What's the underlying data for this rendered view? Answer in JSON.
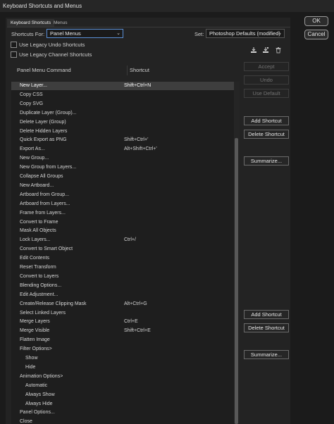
{
  "window": {
    "title": "Keyboard Shortcuts and Menus"
  },
  "tabs": [
    {
      "label": "Keyboard Shortcuts"
    },
    {
      "label": "Menus"
    }
  ],
  "shortcuts_for": {
    "label": "Shortcuts For:",
    "value": "Panel Menus"
  },
  "set": {
    "label": "Set:",
    "value": "Photoshop Defaults (modified)"
  },
  "options": {
    "legacy_undo": {
      "label": "Use Legacy Undo Shortcuts",
      "checked": false
    },
    "legacy_channel": {
      "label": "Use Legacy Channel Shortcuts",
      "checked": false
    }
  },
  "icons": {
    "save_set": "save-set-icon",
    "save_set_copy": "save-set-copy-icon",
    "delete_set": "trash-icon"
  },
  "table": {
    "headers": {
      "command": "Panel Menu Command",
      "shortcut": "Shortcut"
    },
    "rows": [
      {
        "cmd": "New Layer...",
        "sc": "Shift+Ctrl+N",
        "indent": 1,
        "selected": true
      },
      {
        "cmd": "Copy CSS",
        "sc": "",
        "indent": 1
      },
      {
        "cmd": "Copy SVG",
        "sc": "",
        "indent": 1
      },
      {
        "cmd": "Duplicate Layer (Group)...",
        "sc": "",
        "indent": 1
      },
      {
        "cmd": "Delete Layer (Group)",
        "sc": "",
        "indent": 1
      },
      {
        "cmd": "Delete Hidden Layers",
        "sc": "",
        "indent": 1
      },
      {
        "cmd": "Quick Export as PNG",
        "sc": "Shift+Ctrl+'",
        "indent": 1
      },
      {
        "cmd": "Export As...",
        "sc": "Alt+Shift+Ctrl+'",
        "indent": 1
      },
      {
        "cmd": "New Group...",
        "sc": "",
        "indent": 1
      },
      {
        "cmd": "New Group from Layers...",
        "sc": "",
        "indent": 1
      },
      {
        "cmd": "Collapse All Groups",
        "sc": "",
        "indent": 1
      },
      {
        "cmd": "New Artboard...",
        "sc": "",
        "indent": 1
      },
      {
        "cmd": "Artboard from Group...",
        "sc": "",
        "indent": 1
      },
      {
        "cmd": "Artboard from Layers...",
        "sc": "",
        "indent": 1
      },
      {
        "cmd": "Frame from Layers...",
        "sc": "",
        "indent": 1
      },
      {
        "cmd": "Convert to Frame",
        "sc": "",
        "indent": 1
      },
      {
        "cmd": "Mask All Objects",
        "sc": "",
        "indent": 1
      },
      {
        "cmd": "Lock Layers...",
        "sc": "Ctrl+/",
        "indent": 1
      },
      {
        "cmd": "Convert to Smart Object",
        "sc": "",
        "indent": 1
      },
      {
        "cmd": "Edit Contents",
        "sc": "",
        "indent": 1
      },
      {
        "cmd": "Reset Transform",
        "sc": "",
        "indent": 1
      },
      {
        "cmd": "Convert to Layers",
        "sc": "",
        "indent": 1
      },
      {
        "cmd": "Blending Options...",
        "sc": "",
        "indent": 1
      },
      {
        "cmd": "Edit Adjustment...",
        "sc": "",
        "indent": 1
      },
      {
        "cmd": "Create/Release Clipping Mask",
        "sc": "Alt+Ctrl+G",
        "indent": 1
      },
      {
        "cmd": "Select Linked Layers",
        "sc": "",
        "indent": 1
      },
      {
        "cmd": "Merge Layers",
        "sc": "Ctrl+E",
        "indent": 1
      },
      {
        "cmd": "Merge Visible",
        "sc": "Shift+Ctrl+E",
        "indent": 1
      },
      {
        "cmd": "Flatten Image",
        "sc": "",
        "indent": 1
      },
      {
        "cmd": "Filter Options>",
        "sc": "",
        "indent": 1
      },
      {
        "cmd": "Show",
        "sc": "",
        "indent": 2
      },
      {
        "cmd": "Hide",
        "sc": "",
        "indent": 2
      },
      {
        "cmd": "Animation Options>",
        "sc": "",
        "indent": 1
      },
      {
        "cmd": "Automatic",
        "sc": "",
        "indent": 2
      },
      {
        "cmd": "Always Show",
        "sc": "",
        "indent": 2
      },
      {
        "cmd": "Always Hide",
        "sc": "",
        "indent": 2
      },
      {
        "cmd": "Panel Options...",
        "sc": "",
        "indent": 1
      },
      {
        "cmd": "Close",
        "sc": "",
        "indent": 1
      }
    ]
  },
  "buttons": {
    "ok": "OK",
    "cancel": "Cancel",
    "accept": "Accept",
    "undo": "Undo",
    "use_default": "Use Default",
    "add_shortcut": "Add Shortcut",
    "delete_shortcut": "Delete Shortcut",
    "summarize": "Summarize..."
  }
}
